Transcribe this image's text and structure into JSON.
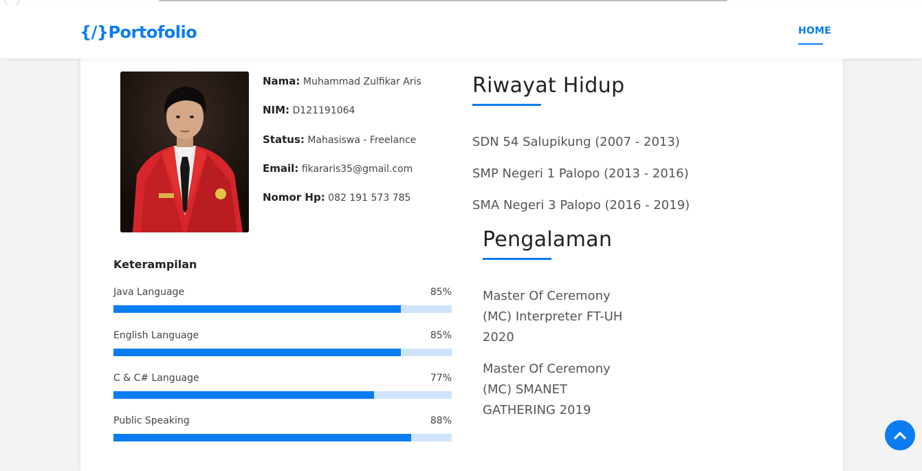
{
  "header": {
    "logo": "{/}Portofolio",
    "nav_home": "HOME"
  },
  "profile": {
    "rows": [
      {
        "label": "Nama:",
        "value": "Muhammad Zulfikar Aris"
      },
      {
        "label": "NIM:",
        "value": "D121191064"
      },
      {
        "label": "Status:",
        "value": "Mahasiswa - Freelance"
      },
      {
        "label": "Email:",
        "value": "fikararis35@gmail.com"
      },
      {
        "label": "Nomor Hp:",
        "value": "082 191 573 785"
      }
    ]
  },
  "skills": {
    "title": "Keterampilan",
    "items": [
      {
        "name": "Java Language",
        "percent_label": "85%",
        "level": 85
      },
      {
        "name": "English Language",
        "percent_label": "85%",
        "level": 85
      },
      {
        "name": "C & C# Language",
        "percent_label": "77%",
        "level": 77
      },
      {
        "name": "Public Speaking",
        "percent_label": "88%",
        "level": 88
      }
    ]
  },
  "riwayat": {
    "title": "Riwayat Hidup",
    "items": [
      "SDN 54 Salupikung (2007 - 2013)",
      "SMP Negeri 1 Palopo (2013 - 2016)",
      "SMA Negeri 3 Palopo (2016 - 2019)"
    ]
  },
  "pengalaman": {
    "title": "Pengalaman",
    "items": [
      "Master Of Ceremony (MC) Interpreter FT-UH 2020",
      "Master Of Ceremony (MC) SMANET GATHERING 2019"
    ]
  },
  "icons": {
    "back_to_top": "chevron-up-icon"
  },
  "colors": {
    "accent": "#0b7cf2",
    "bar_track": "#cfe3fb"
  }
}
